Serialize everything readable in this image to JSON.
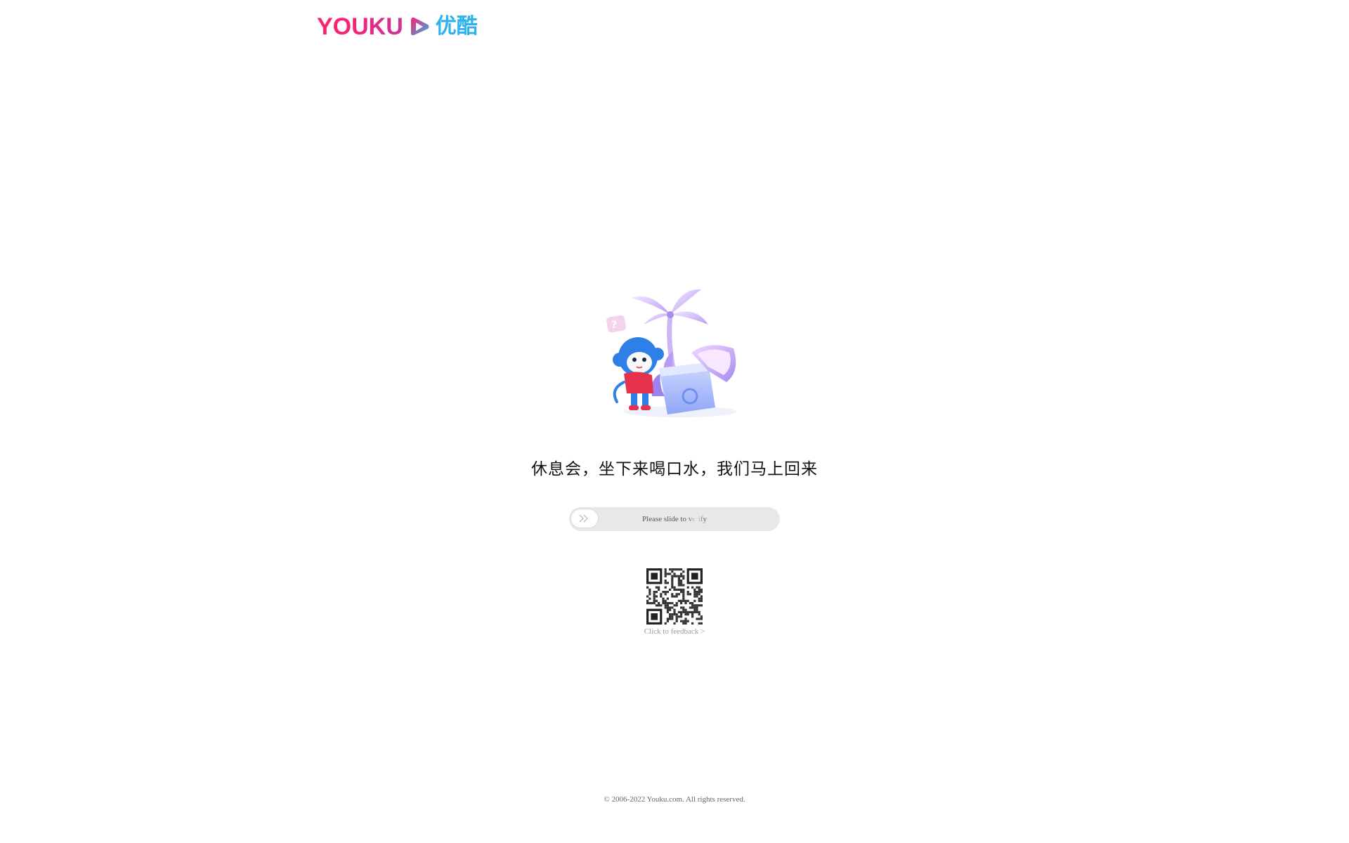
{
  "header": {
    "logo_text": "YOUKU",
    "logo_cn": "优酷",
    "logo_colors": {
      "pink": "#ff1f6b",
      "blue": "#2bb3f0"
    }
  },
  "main": {
    "message": "休息会，坐下来喝口水，我们马上回来",
    "slider": {
      "hint_prefix": "Please slide to ",
      "hint_faded": "verify",
      "knob_icon": "double-chevron-right-icon"
    },
    "qr_icon": "qr-code-icon",
    "feedback_label": "Click to feedback >"
  },
  "footer": {
    "copyright": "© 2006-2022 Youku.com. All rights reserved."
  }
}
